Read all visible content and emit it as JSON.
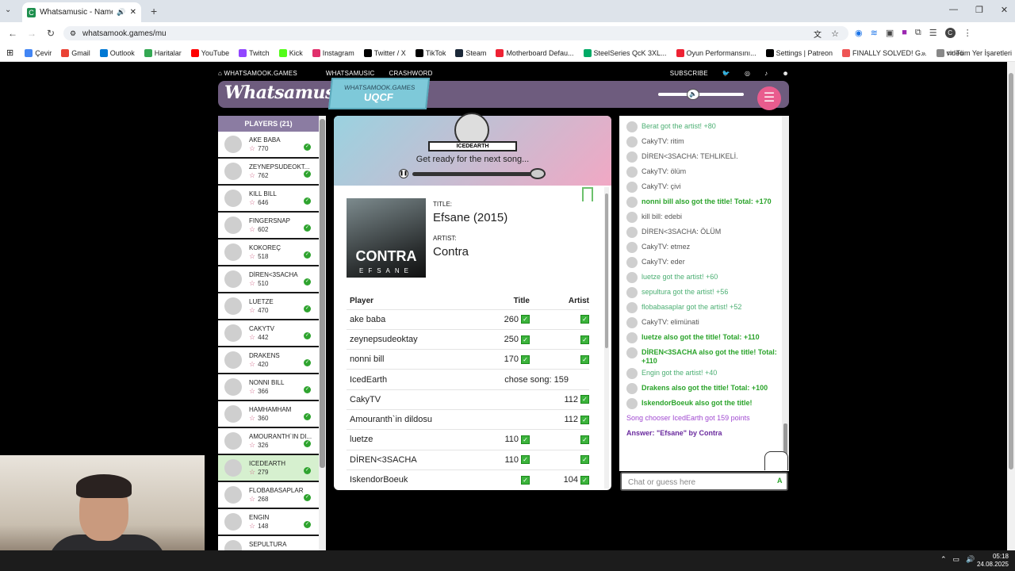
{
  "browser": {
    "tab_title": "Whatsamusic - Name That",
    "url": "whatsamook.games/mu",
    "bookmarks": [
      "Çevir",
      "Gmail",
      "Outlook",
      "Haritalar",
      "YouTube",
      "Twitch",
      "Kick",
      "Instagram",
      "Twitter / X",
      "TikTok",
      "Steam",
      "Motherboard Defau...",
      "SteelSeries QcK 3XL...",
      "Oyun Performansını...",
      "Settings | Patreon",
      "FINALLY SOLVED! G...",
      "video"
    ],
    "other_bookmarks": "Tüm Yer İşaretleri"
  },
  "topnav": {
    "home": "WHATSAMOOK.GAMES",
    "whatsamusic": "WHATSAMUSIC",
    "crashword": "CRASHWORD",
    "subscribe": "SUBSCRIBE"
  },
  "header": {
    "logo": "Whatsamusic",
    "badge_top": "WHATSAMOOK.GAMES",
    "badge_code": "UQCF"
  },
  "players": {
    "title": "PLAYERS (21)",
    "list": [
      {
        "name": "AKE BABA",
        "score": "770"
      },
      {
        "name": "ZEYNEPSUDEOKT...",
        "score": "762"
      },
      {
        "name": "KILL BILL",
        "score": "646"
      },
      {
        "name": "FINGERSNAP",
        "score": "602"
      },
      {
        "name": "KOKOREÇ",
        "score": "518"
      },
      {
        "name": "DİREN<3SACHA",
        "score": "510"
      },
      {
        "name": "LUETZE",
        "score": "470"
      },
      {
        "name": "CAKYTV",
        "score": "442"
      },
      {
        "name": "DRAKENS",
        "score": "420"
      },
      {
        "name": "NONNI BILL",
        "score": "366"
      },
      {
        "name": "HAMHAMHAM",
        "score": "360"
      },
      {
        "name": "AMOURANTH`IN DI...",
        "score": "326"
      },
      {
        "name": "ICEDEARTH",
        "score": "279"
      },
      {
        "name": "FLOBABASAPLAR",
        "score": "268"
      },
      {
        "name": "ENGIN",
        "score": "148"
      },
      {
        "name": "SEPULTURA",
        "score": ""
      }
    ]
  },
  "round": {
    "chooser": "ICEDEARTH",
    "status": "Get ready for the next song...",
    "title_label": "TITLE:",
    "title": "Efsane (2015)",
    "artist_label": "ARTIST:",
    "artist": "Contra",
    "cover_text": "CONTRA",
    "cover_sub": "EFSANE"
  },
  "scoreboard": {
    "headers": [
      "Player",
      "Title",
      "Artist"
    ],
    "rows": [
      {
        "player": "ake baba",
        "title_pts": "260",
        "title_ok": true,
        "artist_pts": "",
        "artist_ok": true
      },
      {
        "player": "zeynepsudeoktay",
        "title_pts": "250",
        "title_ok": true,
        "artist_pts": "",
        "artist_ok": true
      },
      {
        "player": "nonni bill",
        "title_pts": "170",
        "title_ok": true,
        "artist_pts": "",
        "artist_ok": true
      },
      {
        "player": "IcedEarth",
        "note": "chose song: 159"
      },
      {
        "player": "CakyTV",
        "title_pts": "",
        "title_ok": false,
        "artist_pts": "112",
        "artist_ok": true
      },
      {
        "player": "Amouranth`in dildosu",
        "title_pts": "",
        "title_ok": false,
        "artist_pts": "112",
        "artist_ok": true
      },
      {
        "player": "luetze",
        "title_pts": "110",
        "title_ok": true,
        "artist_pts": "",
        "artist_ok": true
      },
      {
        "player": "DİREN<3SACHA",
        "title_pts": "110",
        "title_ok": true,
        "artist_pts": "",
        "artist_ok": true
      },
      {
        "player": "IskendorBoeuk",
        "title_pts": "",
        "title_ok": true,
        "artist_pts": "104",
        "artist_ok": true
      }
    ]
  },
  "chat": {
    "messages": [
      {
        "text": "Berat got the artist! +80",
        "style": "green",
        "avatar": true
      },
      {
        "text": "CakyTV: ritim",
        "style": "gray",
        "avatar": true
      },
      {
        "text": "DİREN<3SACHA: TEHLIKELİ.",
        "style": "gray",
        "avatar": true
      },
      {
        "text": "CakyTV: ölüm",
        "style": "gray",
        "avatar": true
      },
      {
        "text": "CakyTV: çivi",
        "style": "gray",
        "avatar": true
      },
      {
        "text": "nonni bill also got the title! Total: +170",
        "style": "bold",
        "avatar": true
      },
      {
        "text": "kill bill: edebi",
        "style": "gray",
        "avatar": true
      },
      {
        "text": "DİREN<3SACHA: ÖLÜM",
        "style": "gray",
        "avatar": true
      },
      {
        "text": "CakyTV: etmez",
        "style": "gray",
        "avatar": true
      },
      {
        "text": "CakyTV: eder",
        "style": "gray",
        "avatar": true
      },
      {
        "text": "luetze got the artist! +60",
        "style": "green",
        "avatar": true
      },
      {
        "text": "sepultura got the artist! +56",
        "style": "green",
        "avatar": true
      },
      {
        "text": "flobabasaplar got the artist! +52",
        "style": "green",
        "avatar": true
      },
      {
        "text": "CakyTV: elimünati",
        "style": "gray",
        "avatar": true
      },
      {
        "text": "luetze also got the title! Total: +110",
        "style": "bold",
        "avatar": true
      },
      {
        "text": "DİREN<3SACHA also got the title! Total: +110",
        "style": "bold",
        "avatar": true
      },
      {
        "text": "Engin got the artist! +40",
        "style": "green",
        "avatar": true
      },
      {
        "text": "Drakens also got the title! Total: +100",
        "style": "bold",
        "avatar": true
      },
      {
        "text": "IskendorBoeuk also got the title!",
        "style": "bold",
        "avatar": true
      },
      {
        "text": "Song chooser IcedEarth got 159 points",
        "style": "purple",
        "avatar": false
      },
      {
        "text": "Answer: \"Efsane\" by Contra",
        "style": "answer",
        "avatar": false
      }
    ],
    "placeholder": "Chat or guess here"
  },
  "taskbar": {
    "time": "05:18",
    "date": "24.08.2025"
  },
  "colors": {
    "header": "#6e5c7e",
    "players_head": "#8b7ca2",
    "accent_pink": "#e95c8e",
    "badge": "#7ec9d9",
    "check": "#3bb33b"
  }
}
